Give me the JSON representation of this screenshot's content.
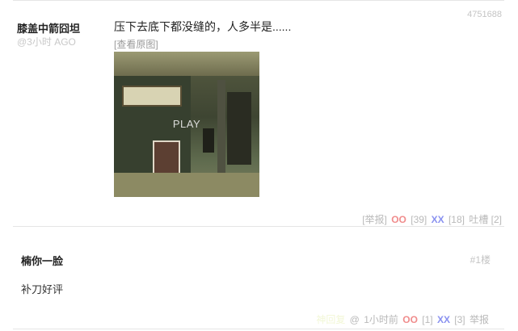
{
  "post": {
    "author": "膝盖中箭囧坦",
    "time": "@3小时 AGO",
    "id": "4751688",
    "text": "压下去底下都没缝的，人多半是......",
    "view_original": "[查看原图]",
    "media_label": "PLAY",
    "actions": {
      "report": "[举报]",
      "oo_label": "OO",
      "oo_count": "[39]",
      "xx_label": "XX",
      "xx_count": "[18]",
      "tucao": "吐槽 [2]"
    }
  },
  "comment": {
    "author": "楠你一脸",
    "floor": "#1楼",
    "text": "补刀好评",
    "faint_text": "神回复",
    "at": "@",
    "time": "1小时前",
    "oo_label": "OO",
    "oo_count": "[1]",
    "xx_label": "XX",
    "xx_count": "[3]",
    "report": "举报"
  },
  "colors": {
    "oo": "#f08c8c",
    "xx": "#8a92f0",
    "muted": "#b9b9b9"
  }
}
